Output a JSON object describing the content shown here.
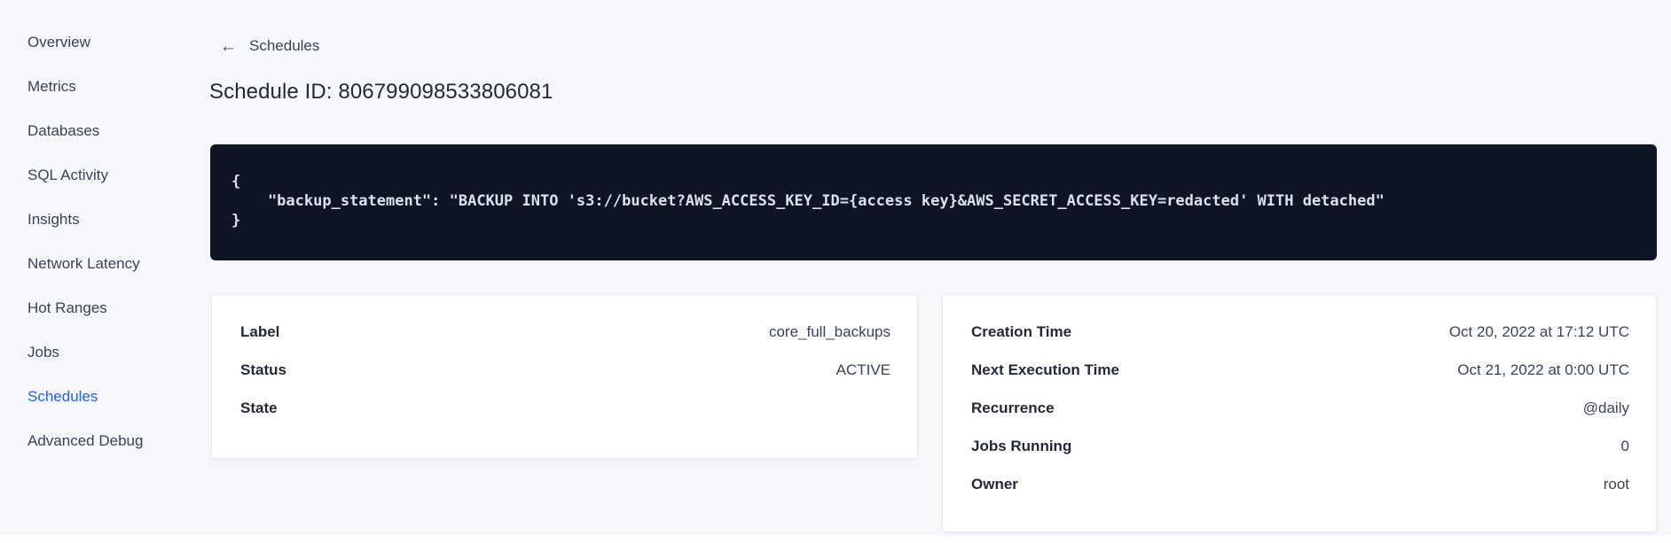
{
  "sidebar": {
    "items": [
      {
        "label": "Overview",
        "active": false
      },
      {
        "label": "Metrics",
        "active": false
      },
      {
        "label": "Databases",
        "active": false
      },
      {
        "label": "SQL Activity",
        "active": false
      },
      {
        "label": "Insights",
        "active": false
      },
      {
        "label": "Network Latency",
        "active": false
      },
      {
        "label": "Hot Ranges",
        "active": false
      },
      {
        "label": "Jobs",
        "active": false
      },
      {
        "label": "Schedules",
        "active": true
      },
      {
        "label": "Advanced Debug",
        "active": false
      }
    ]
  },
  "header": {
    "back_icon": "←",
    "back_label": "Schedules",
    "title": "Schedule ID: 806799098533806081"
  },
  "code_block": {
    "lines": [
      "{",
      "    \"backup_statement\": \"BACKUP INTO 's3://bucket?AWS_ACCESS_KEY_ID={access key}&AWS_SECRET_ACCESS_KEY=redacted' WITH detached\"",
      "}"
    ]
  },
  "details_left": {
    "rows": [
      {
        "label": "Label",
        "value": "core_full_backups"
      },
      {
        "label": "Status",
        "value": "ACTIVE"
      },
      {
        "label": "State",
        "value": ""
      }
    ]
  },
  "details_right": {
    "rows": [
      {
        "label": "Creation Time",
        "value": "Oct 20, 2022 at 17:12 UTC"
      },
      {
        "label": "Next Execution Time",
        "value": "Oct 21, 2022 at 0:00 UTC"
      },
      {
        "label": "Recurrence",
        "value": "@daily"
      },
      {
        "label": "Jobs Running",
        "value": "0"
      },
      {
        "label": "Owner",
        "value": "root"
      }
    ]
  },
  "colors": {
    "background": "#f5f7fa",
    "code_background": "#0e1524",
    "code_text": "#dbe0ea",
    "nav_text": "#394455",
    "nav_active": "#2262f2",
    "heading_text": "#242a35",
    "card_background": "#ffffff",
    "card_border": "#e7ebf1"
  }
}
